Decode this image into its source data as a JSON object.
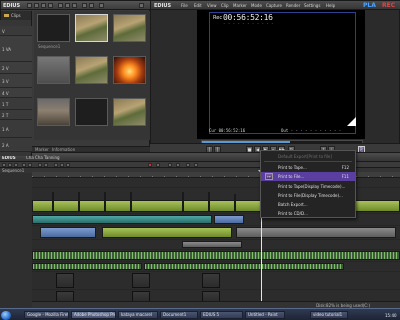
{
  "colors": {
    "accent": "#5a3fa0",
    "monitor_safe_area": "#2c3f90",
    "brand_blue": "#4ea3ff",
    "brand_red": "#e84141"
  },
  "bin": {
    "app_name": "EDIUS",
    "tree_root": "Clips",
    "thumbs": [
      {
        "caption": "Sequence1"
      },
      {
        "caption": ""
      },
      {
        "caption": ""
      },
      {
        "caption": ""
      },
      {
        "caption": ""
      },
      {
        "caption": ""
      },
      {
        "caption": ""
      },
      {
        "caption": ""
      },
      {
        "caption": ""
      }
    ],
    "tabs": {
      "bin": "Bin",
      "effect": "Effect",
      "marker": "Marker",
      "information": "Information"
    }
  },
  "player": {
    "app_name": "EDIUS",
    "menu": [
      "File",
      "Edit",
      "View",
      "Clip",
      "Marker",
      "Mode",
      "Capture",
      "Render",
      "Settings",
      "Help"
    ],
    "brand": {
      "part1": "PLA",
      "part2": "REC"
    },
    "rec_label": "Rec",
    "timecode": "00:56:52:16",
    "timecode_sub": "- - - - - - - - - - -",
    "tc_in": "Cur 00:56:52:16",
    "tc_out": "Out - - - - - - - - - - -",
    "scrub_progress": 0.55
  },
  "transport": {
    "buttons": [
      {
        "icon": "set-in-icon",
        "glyph": "["
      },
      {
        "icon": "set-out-icon",
        "glyph": "]"
      },
      {
        "icon": "stop-icon",
        "glyph": "■"
      },
      {
        "icon": "rewind-icon",
        "glyph": "◀"
      },
      {
        "icon": "play-icon",
        "glyph": "▶"
      },
      {
        "icon": "step-forward-icon",
        "glyph": "▸"
      },
      {
        "icon": "fast-forward-icon",
        "glyph": "▶▶"
      },
      {
        "icon": "loop-icon",
        "glyph": "↻"
      },
      {
        "icon": "overwrite-icon",
        "glyph": "↧"
      },
      {
        "icon": "insert-icon",
        "glyph": "⇣"
      },
      {
        "icon": "export-icon",
        "glyph": "⎘"
      }
    ]
  },
  "timeline": {
    "app_name": "EDIUS",
    "project": "Cha Cha Tanning",
    "sequence_tab": "Sequence1",
    "tracks": [
      {
        "name": "V"
      },
      {
        "name": "1 VA"
      },
      {
        "name": "2 V"
      },
      {
        "name": "3 V"
      },
      {
        "name": "4 V"
      },
      {
        "name": "1 T"
      },
      {
        "name": "2 T"
      },
      {
        "name": "1 A"
      },
      {
        "name": "2 A"
      }
    ],
    "status": "Disk:82% is being used(C:)"
  },
  "menu": {
    "items": [
      {
        "label": "Default Export[Print to file]",
        "shortcut": "",
        "state": "disabled"
      },
      {
        "label": "Print to Tape...",
        "shortcut": "F12",
        "state": "normal"
      },
      {
        "label": "Print to File...",
        "shortcut": "F11",
        "state": "active"
      },
      {
        "label": "Print to Tape(Display Timecode)...",
        "shortcut": "",
        "state": "normal"
      },
      {
        "label": "Print to File(Display Timecode)...",
        "shortcut": "",
        "state": "normal"
      },
      {
        "label": "Batch Export...",
        "shortcut": "",
        "state": "normal"
      },
      {
        "label": "Print to CD/D...",
        "shortcut": "",
        "state": "normal"
      }
    ]
  },
  "taskbar": {
    "tasks": [
      {
        "label": "Google - Mozilla Firef..."
      },
      {
        "label": "Adobe Photoshop Pro"
      },
      {
        "label": "kataya macarel"
      },
      {
        "label": "Document1"
      },
      {
        "label": "EDIUS 5"
      },
      {
        "label": "Untitled - Paint"
      },
      {
        "label": "video tutorial1"
      }
    ],
    "clock": "15:40"
  }
}
